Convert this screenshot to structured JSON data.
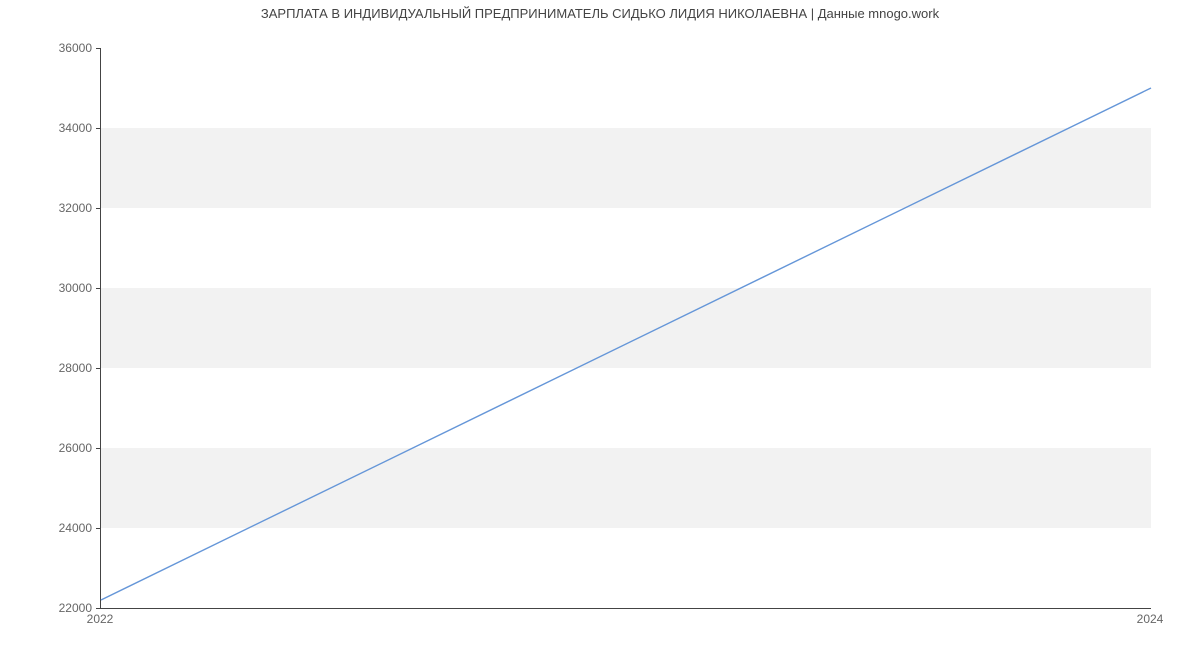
{
  "chart_data": {
    "type": "line",
    "title": "ЗАРПЛАТА В ИНДИВИДУАЛЬНЫЙ ПРЕДПРИНИМАТЕЛЬ СИДЬКО ЛИДИЯ НИКОЛАЕВНА | Данные mnogo.work",
    "x": [
      2022,
      2024
    ],
    "values": [
      22200,
      35000
    ],
    "xlabel": "",
    "ylabel": "",
    "xlim": [
      2022,
      2024
    ],
    "ylim": [
      22000,
      36000
    ],
    "y_ticks": [
      22000,
      24000,
      26000,
      28000,
      30000,
      32000,
      34000,
      36000
    ],
    "x_ticks": [
      2022,
      2024
    ],
    "line_color": "#6596d8",
    "bands": true
  }
}
